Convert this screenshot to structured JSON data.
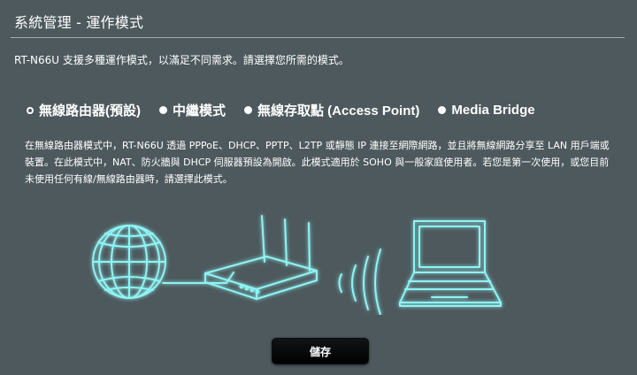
{
  "page": {
    "title": "系統管理 - 運作模式",
    "intro": "RT-N66U 支援多種運作模式，以滿足不同需求。請選擇您所需的模式。"
  },
  "modes": [
    {
      "label": "無線路由器(預設)",
      "selected": true
    },
    {
      "label": "中繼模式",
      "selected": false
    },
    {
      "label": "無線存取點 (Access Point)",
      "selected": false
    },
    {
      "label": "Media Bridge",
      "selected": false
    }
  ],
  "description": "在無線路由器模式中，RT-N66U 透過 PPPoE、DHCP、PPTP、L2TP 或靜態 IP 連接至網際網路，並且將無線網路分享至 LAN 用戶端或裝置。在此模式中，NAT、防火牆與 DHCP 伺服器預設為開啟。此模式適用於 SOHO 與一般家庭使用者。若您是第一次使用，或您目前未使用任何有線/無線路由器時，請選擇此模式。",
  "illustration": {
    "icons": [
      "globe-icon",
      "router-icon",
      "wifi-waves-icon",
      "laptop-icon"
    ],
    "glow_color": "#8ff4f4"
  },
  "actions": {
    "save_label": "儲存"
  },
  "colors": {
    "background": "#4d595d",
    "divider": "#a0aeb2",
    "button": "#000000"
  }
}
